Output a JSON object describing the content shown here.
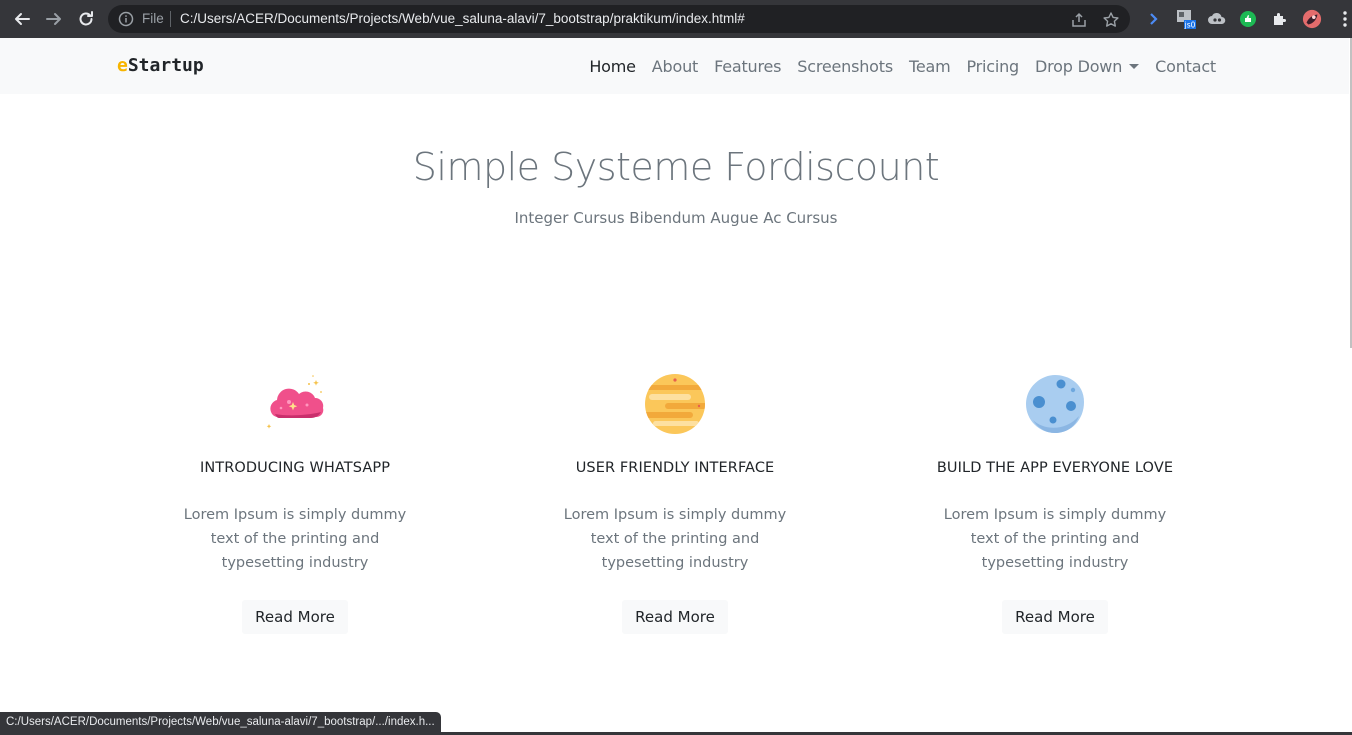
{
  "browser": {
    "scheme_label": "File",
    "url": "C:/Users/ACER/Documents/Projects/Web/vue_saluna-alavi/7_bootstrap/praktikum/index.html#",
    "status_url": "C:/Users/ACER/Documents/Projects/Web/vue_saluna-alavi/7_bootstrap/.../index.h...",
    "extension_badge": "js0"
  },
  "navbar": {
    "brand_accent": "e",
    "brand_rest": "Startup",
    "links": [
      "Home",
      "About",
      "Features",
      "Screenshots",
      "Team",
      "Pricing",
      "Drop Down",
      "Contact"
    ],
    "active": "Home"
  },
  "hero": {
    "title": "Simple Systeme Fordiscount",
    "subtitle": "Integer Cursus Bibendum Augue Ac Cursus"
  },
  "features": [
    {
      "icon": "cloud-icon",
      "title": "INTRODUCING WHATSAPP",
      "text": "Lorem Ipsum is simply dummy text of the printing and typesetting industry",
      "button": "Read More"
    },
    {
      "icon": "planet-icon",
      "title": "USER FRIENDLY INTERFACE",
      "text": "Lorem Ipsum is simply dummy text of the printing and typesetting industry",
      "button": "Read More"
    },
    {
      "icon": "moon-icon",
      "title": "BUILD THE APP EVERYONE LOVE",
      "text": "Lorem Ipsum is simply dummy text of the printing and typesetting industry",
      "button": "Read More"
    }
  ],
  "colors": {
    "brand_accent": "#f7b500",
    "navbar_bg": "#f8f9fa",
    "chrome_bg": "#35363a",
    "muted_text": "#6c757d"
  }
}
